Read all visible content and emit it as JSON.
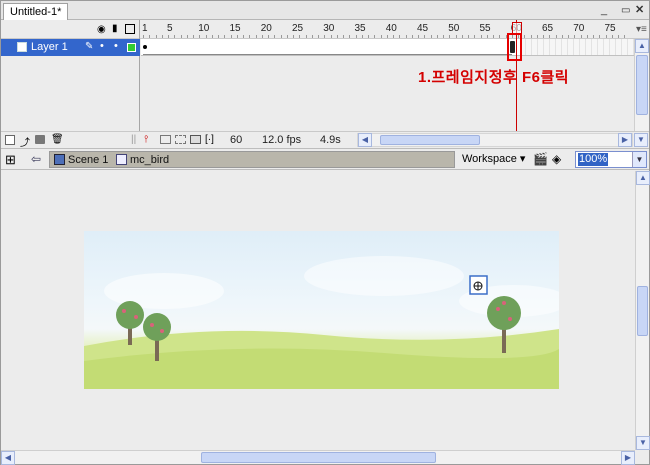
{
  "document_tab": {
    "title": "Untitled-1*"
  },
  "window_controls": {
    "restore_icon": "restore-icon",
    "close_label": "✕"
  },
  "timeline": {
    "frame_numbers": [
      "1",
      "5",
      "10",
      "15",
      "20",
      "25",
      "30",
      "35",
      "40",
      "45",
      "50",
      "55",
      "60",
      "65",
      "70",
      "75"
    ],
    "layer": {
      "name": "Layer 1"
    },
    "current_frame": "60",
    "frame_rate": "12.0 fps",
    "elapsed_time": "4.9s"
  },
  "annotation": {
    "text": "1.프레임지정후 F6클릭"
  },
  "edit_bar": {
    "breadcrumbs": [
      {
        "label": "Scene 1"
      },
      {
        "label": "mc_bird"
      }
    ],
    "workspace_label": "Workspace",
    "zoom_value": "100%"
  },
  "colors": {
    "accent": "#3366cc",
    "annotation": "#d40000",
    "layer_color": "#33cc33"
  }
}
